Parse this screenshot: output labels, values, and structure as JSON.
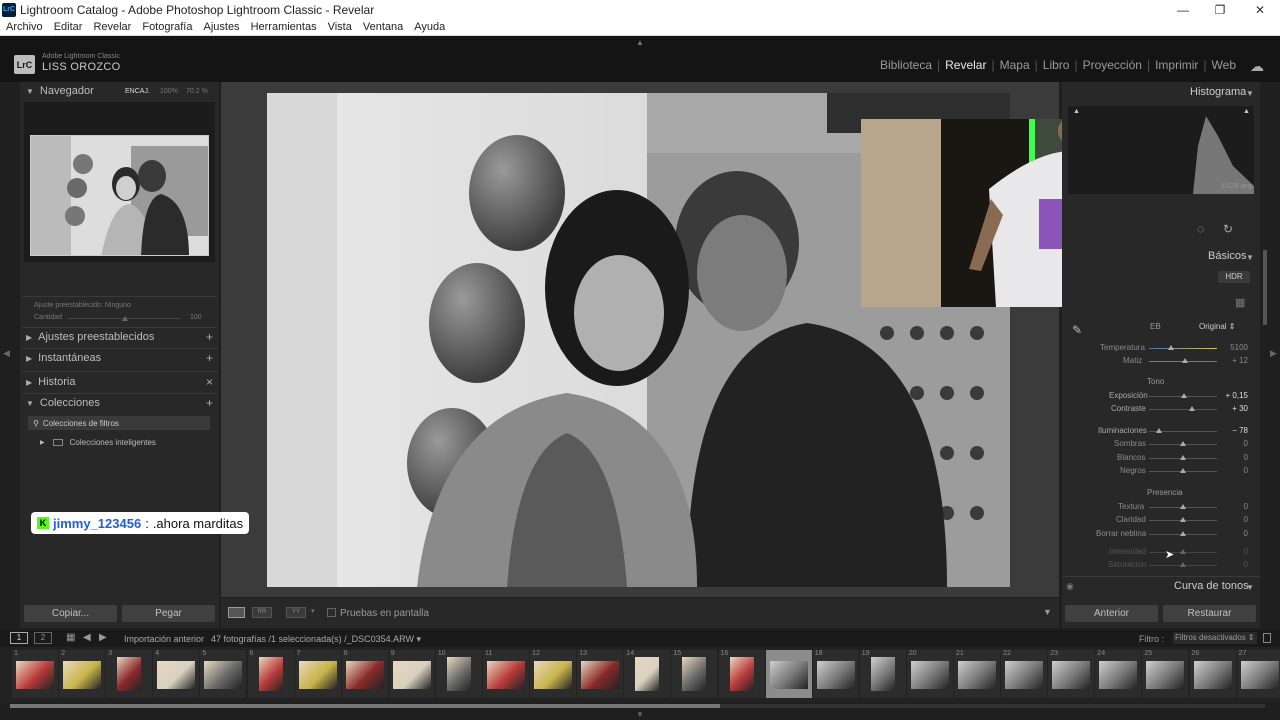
{
  "window": {
    "title": "Lightroom Catalog - Adobe Photoshop Lightroom Classic - Revelar",
    "logo": "LrC"
  },
  "menu": [
    "Archivo",
    "Editar",
    "Revelar",
    "Fotografía",
    "Ajustes",
    "Herramientas",
    "Vista",
    "Ventana",
    "Ayuda"
  ],
  "identity": {
    "product": "Adobe Lightroom Classic",
    "user": "LISS OROZCO",
    "badge": "LrC"
  },
  "modules": [
    "Biblioteca",
    "Revelar",
    "Mapa",
    "Libro",
    "Proyección",
    "Imprimir",
    "Web"
  ],
  "active_module": "Revelar",
  "left": {
    "navigator": {
      "title": "Navegador",
      "fit": "ENCAJ.",
      "z1": "100%",
      "z2": "70.2 %"
    },
    "preset_amount": {
      "label": "Ajuste preestablecido:",
      "value": "Ninguno",
      "amount_label": "Cantidad",
      "amount": "100"
    },
    "sections": [
      {
        "label": "Ajustes preestablecidos",
        "action": "+"
      },
      {
        "label": "Instantáneas",
        "action": "+"
      },
      {
        "label": "Historia",
        "action": "×"
      },
      {
        "label": "Colecciones",
        "action": "+"
      }
    ],
    "collections": [
      "Colecciones de filtros",
      "Colecciones inteligentes"
    ],
    "copy_button": "Copiar...",
    "paste_button": "Pegar"
  },
  "right": {
    "histogram_title": "Histograma",
    "shutter": "1/125 seg",
    "basics_title": "Básicos",
    "hdr": "HDR",
    "wb": {
      "label": "EB",
      "value": "Original"
    },
    "temp": {
      "label": "Temperatura",
      "value": "5100"
    },
    "tint": {
      "label": "Matiz",
      "value": "+ 12"
    },
    "tone_title": "Tono",
    "tone": [
      {
        "label": "Exposición",
        "value": "+ 0,15",
        "pos": 0.52
      },
      {
        "label": "Contraste",
        "value": "+ 30",
        "pos": 0.62
      }
    ],
    "tone2": [
      {
        "label": "Iluminaciones",
        "value": "− 78",
        "pos": 0.15
      },
      {
        "label": "Sombras",
        "value": "0",
        "pos": 0.5
      },
      {
        "label": "Blancos",
        "value": "0",
        "pos": 0.5
      },
      {
        "label": "Negros",
        "value": "0",
        "pos": 0.5
      }
    ],
    "presence_title": "Presencia",
    "presence": [
      {
        "label": "Textura",
        "value": "0",
        "pos": 0.5
      },
      {
        "label": "Claridad",
        "value": "0",
        "pos": 0.5
      },
      {
        "label": "Borrar neblina",
        "value": "0",
        "pos": 0.5
      },
      {
        "label": "Intensidad",
        "value": "0",
        "pos": 0.5
      },
      {
        "label": "Saturación",
        "value": "0",
        "pos": 0.5
      }
    ],
    "curve_title": "Curva de tonos",
    "prev_button": "Anterior",
    "reset_button": "Restaurar"
  },
  "toolbar": {
    "proof": "Pruebas en pantalla"
  },
  "filmstrip": {
    "page1": "1",
    "page2": "2",
    "source": "Importación anterior",
    "info": "47 fotografías /1 seleccionada(s) /_DSC0354.ARW",
    "filter_label": "Filtro :",
    "filter_value": "Filtros desactivados",
    "thumb_numbers": [
      "1",
      "2",
      "3",
      "4",
      "5",
      "6",
      "7",
      "8",
      "9",
      "10",
      "11",
      "12",
      "13",
      "14",
      "15",
      "16",
      "17",
      "18",
      "19",
      "20",
      "21",
      "22",
      "23",
      "24",
      "25",
      "26",
      "27"
    ],
    "selected": 17
  },
  "chat": {
    "user": "jimmy_123456",
    "sep": ":",
    "message": ".ahora marditas"
  }
}
